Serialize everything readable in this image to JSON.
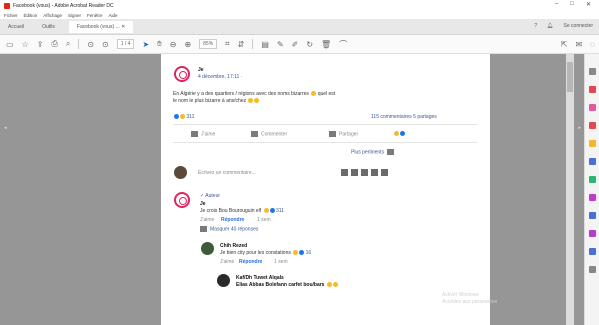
{
  "window": {
    "title": "Facebook (vous) - Adobe Acrobat Reader DC",
    "controls": [
      "–",
      "□",
      "✕"
    ]
  },
  "menu": [
    "Fichier",
    "Édition",
    "Affichage",
    "Signer",
    "Fenêtre",
    "Aide"
  ],
  "tabs": {
    "home": "Accueil",
    "tools": "Outils",
    "document": "Facebook (vous) ... ✕"
  },
  "header_right": {
    "help": "?",
    "user": "Se connecter"
  },
  "toolbar": {
    "page_field": "1 / 4",
    "zoom": "85%"
  },
  "post": {
    "author": "Je",
    "date": "4 décembre, 17:11 ·",
    "text_line1": "En Algérie y a des quartiers / régions avec des noms bizarres",
    "text_line1b": "quel est",
    "text_line2": "le nom le plus bizarre à ans/chez",
    "reactions_count": "311",
    "comments_shares": "115 commentaires  5 partages",
    "actions": {
      "like": "J'aime",
      "comment": "Commenter",
      "share": "Partager"
    },
    "sort": "Plus pertinents",
    "write_placeholder": "Écrivez un commentaire..."
  },
  "comments": [
    {
      "author": "Je",
      "badge": "✓ Auteur",
      "text": "Je crois Bou Bourouguin elf",
      "reactions": "311",
      "like": "J'aime",
      "reply": "Répondre",
      "time": "1 sem",
      "hide": "Masquer 40 réponses"
    },
    {
      "author": "Chih Rezed",
      "text": "Je bien city pour les constations",
      "reactions": "16",
      "like": "J'aime",
      "reply": "Répondre",
      "time": "1 sem"
    },
    {
      "author": "Kaf/Dh Tuwet Alqals",
      "text": "Elias Abbas Bolefann carfet bou/bars"
    }
  ],
  "watermark": {
    "line1": "Activer Windows",
    "line2": "Accédez aux paramètres"
  },
  "right_panel_icons": [
    {
      "name": "search-icon",
      "color": "#888888"
    },
    {
      "name": "export-pdf-icon",
      "color": "#e34850"
    },
    {
      "name": "edit-pdf-icon",
      "color": "#e05a9b"
    },
    {
      "name": "create-pdf-icon",
      "color": "#e34850"
    },
    {
      "name": "comment-icon",
      "color": "#f5b62b"
    },
    {
      "name": "combine-icon",
      "color": "#4b6fd6"
    },
    {
      "name": "organize-icon",
      "color": "#2bb673"
    },
    {
      "name": "compress-icon",
      "color": "#c13cc9"
    },
    {
      "name": "protect-icon",
      "color": "#4b6fd6"
    },
    {
      "name": "fill-sign-icon",
      "color": "#b23ed0"
    },
    {
      "name": "send-icon",
      "color": "#4b6fd6"
    },
    {
      "name": "more-tools-icon",
      "color": "#888888"
    }
  ]
}
